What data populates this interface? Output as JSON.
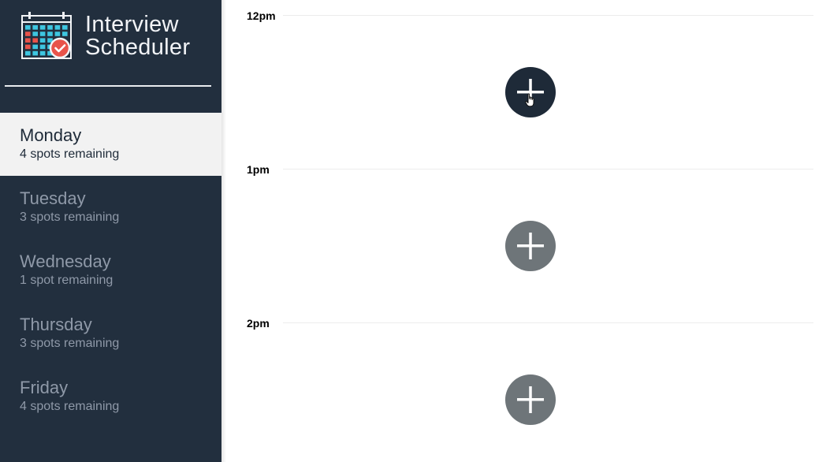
{
  "app": {
    "title_line1": "Interview",
    "title_line2": "Scheduler"
  },
  "sidebar": {
    "days": [
      {
        "name": "Monday",
        "spots": "4 spots remaining",
        "selected": true
      },
      {
        "name": "Tuesday",
        "spots": "3 spots remaining",
        "selected": false
      },
      {
        "name": "Wednesday",
        "spots": "1 spot remaining",
        "selected": false
      },
      {
        "name": "Thursday",
        "spots": "3 spots remaining",
        "selected": false
      },
      {
        "name": "Friday",
        "spots": "4 spots remaining",
        "selected": false
      }
    ]
  },
  "schedule": {
    "slots": [
      {
        "time": "12pm",
        "action_icon": "plus-icon",
        "hovered": true
      },
      {
        "time": "1pm",
        "action_icon": "plus-icon",
        "hovered": false
      },
      {
        "time": "2pm",
        "action_icon": "plus-icon",
        "hovered": false
      }
    ]
  },
  "colors": {
    "sidebar_bg": "#222f3e",
    "selected_day_bg": "#f2f2f2",
    "add_button": "#6e7579",
    "add_button_hover": "#1e2a38",
    "logo_red": "#e8534a",
    "logo_cyan": "#3ec6e0"
  }
}
